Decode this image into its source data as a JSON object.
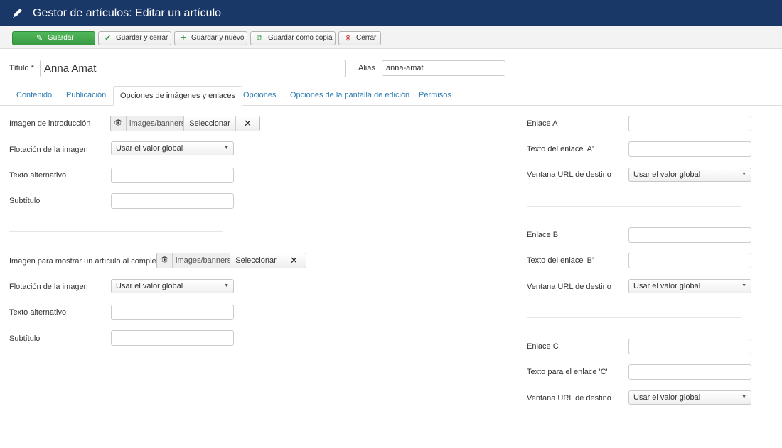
{
  "header": {
    "title": "Gestor de artículos: Editar un artículo",
    "icon": "pencil-icon",
    "bg_color": "#1a3867"
  },
  "toolbar": {
    "save_label": "Guardar",
    "save_close_label": "Guardar y cerrar",
    "save_new_label": "Guardar y nuevo",
    "save_copy_label": "Guardar como copia",
    "close_label": "Cerrar",
    "save_color": "#3a9a44"
  },
  "title_field": {
    "label": "Título *",
    "value": "Anna Amat"
  },
  "alias_field": {
    "label": "Alias",
    "value": "anna-amat"
  },
  "tabs": [
    {
      "label": "Contenido"
    },
    {
      "label": "Publicación"
    },
    {
      "label": "Opciones de imágenes y enlaces",
      "active": true
    },
    {
      "label": "Opciones"
    },
    {
      "label": "Opciones de la pantalla de edición"
    },
    {
      "label": "Permisos"
    }
  ],
  "intro_image": {
    "label": "Imagen de introducción",
    "path": "images/banners",
    "select_label": "Seleccionar",
    "clear_symbol": "✕",
    "float_label": "Flotación de la imagen",
    "float_value": "Usar el valor global",
    "alt_label": "Texto alternativo",
    "alt_value": "",
    "caption_label": "Subtítulo",
    "caption_value": ""
  },
  "full_image": {
    "label": "Imagen para mostrar un artículo al completo",
    "path": "images/banners",
    "select_label": "Seleccionar",
    "clear_symbol": "✕",
    "float_label": "Flotación de la imagen",
    "float_value": "Usar el valor global",
    "alt_label": "Texto alternativo",
    "alt_value": "",
    "caption_label": "Subtítulo",
    "caption_value": ""
  },
  "links": [
    {
      "url_label": "Enlace A",
      "text_label": "Texto del enlace 'A'",
      "window_label": "Ventana URL de destino",
      "window_value": "Usar el valor global"
    },
    {
      "url_label": "Enlace B",
      "text_label": "Texto del enlace 'B'",
      "window_label": "Ventana URL de destino",
      "window_value": "Usar el valor global"
    },
    {
      "url_label": "Enlace C",
      "text_label": "Texto para el enlace 'C'",
      "window_label": "Ventana URL de destino",
      "window_value": "Usar el valor global"
    }
  ]
}
